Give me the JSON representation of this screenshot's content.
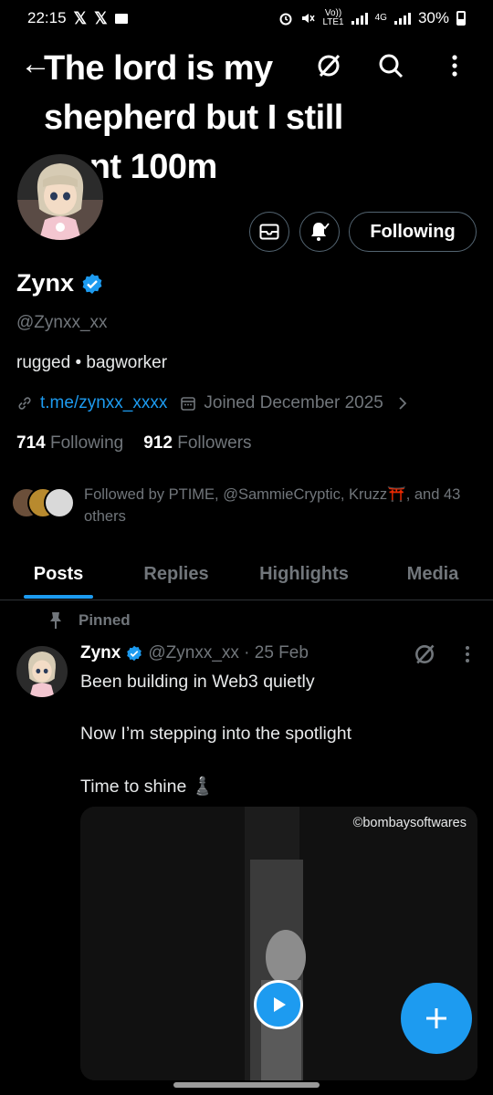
{
  "status_bar": {
    "time": "22:15",
    "x_icon_1": "𝕏",
    "x_icon_2": "𝕏",
    "volte_top": "Vo))",
    "volte_bottom": "LTE1",
    "network": "4G",
    "battery": "30%"
  },
  "header": {
    "title": "The lord is my shepherd but I still want 100m"
  },
  "actions": {
    "following_label": "Following"
  },
  "profile": {
    "display_name": "Zynx",
    "handle": "@Zynxx_xx",
    "bio": "rugged • bagworker",
    "link": "t.me/zynxx_xxxx",
    "joined": "Joined December 2025",
    "following_count": "714",
    "following_label": "Following",
    "followers_count": "912",
    "followers_label": "Followers",
    "followed_by": "Followed by PTIME, @SammieCryptic, Kruzz⛩️, and 43 others"
  },
  "tabs": [
    {
      "label": "Posts",
      "active": true
    },
    {
      "label": "Replies",
      "active": false
    },
    {
      "label": "Highlights",
      "active": false
    },
    {
      "label": "Media",
      "active": false
    }
  ],
  "post": {
    "pinned_label": "Pinned",
    "author": "Zynx",
    "meta": "@Zynxx_xx · 25 Feb",
    "line1": "Been building in Web3 quietly",
    "line2": "Now I’m stepping into the spotlight",
    "line3": "Time to shine ♟️",
    "watermark": "©bombaysoftwares"
  },
  "colors": {
    "accent": "#1d9bf0",
    "background": "#000000",
    "muted": "#71767b"
  }
}
